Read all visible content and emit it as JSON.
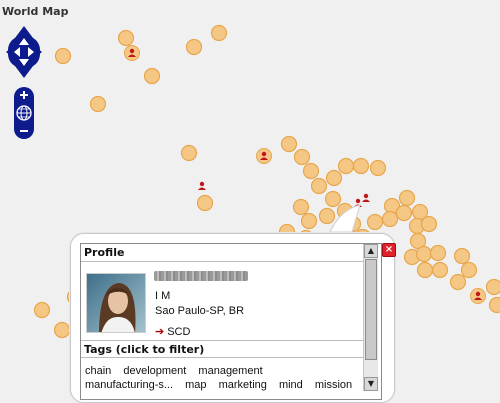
{
  "map": {
    "title": "World Map",
    "colors": {
      "background": "#f0f0f0",
      "cluster_fill": "#f5c785",
      "cluster_stroke": "#e8a64d",
      "user_marker_bg": "#f5c785",
      "user_marker_icon": "#c0151b",
      "nav_control": "#0d1b8c"
    },
    "markers_icon": "person-pin-icon",
    "cluster_icon": "cluster-dot-icon"
  },
  "controls": {
    "pan": [
      "pan-up-icon",
      "pan-left-icon",
      "pan-right-icon",
      "pan-down-icon"
    ],
    "zoom_in": "+",
    "zoom_out": "−",
    "globe_icon": "globe-icon"
  },
  "popup": {
    "profile_heading": "Profile",
    "person": {
      "name_redacted": true,
      "initials": "I M",
      "location": "Sao Paulo-SP, BR",
      "link_label": "SCD"
    },
    "tags_heading": "Tags (click to filter)",
    "tags": [
      "chain",
      "development",
      "management",
      "manufacturing-s...",
      "map",
      "marketing",
      "mind",
      "mission"
    ],
    "close_label": "×"
  }
}
